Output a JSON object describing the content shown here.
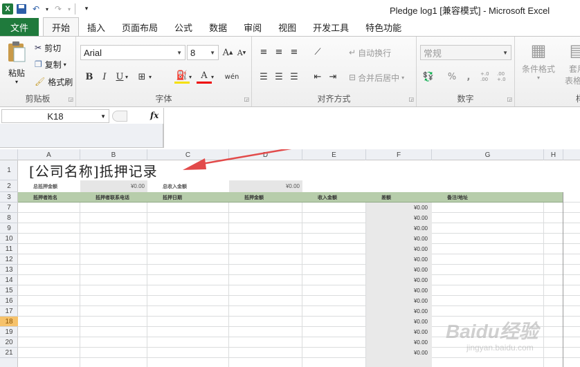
{
  "window": {
    "title": "Pledge log1  [兼容模式]  -  Microsoft Excel",
    "logo": "X"
  },
  "tabs": [
    "文件",
    "开始",
    "插入",
    "页面布局",
    "公式",
    "数据",
    "审阅",
    "视图",
    "开发工具",
    "特色功能"
  ],
  "ribbon": {
    "clipboard": {
      "paste": "粘贴",
      "cut": "剪切",
      "copy": "复制",
      "format_painter": "格式刷",
      "label": "剪贴板"
    },
    "font": {
      "name": "Arial",
      "size": "8",
      "label": "字体",
      "bold": "B",
      "italic": "I",
      "underline": "U"
    },
    "alignment": {
      "wrap_text": "自动换行",
      "merge_center": "合并后居中",
      "label": "对齐方式"
    },
    "number": {
      "format": "常规",
      "percent": "%",
      "comma": ",",
      "inc_decimal": "+.0 .00",
      "dec_decimal": ".00 +.0",
      "label": "数字"
    },
    "styles": {
      "conditional": "条件格式",
      "table_format_1": "套用",
      "table_format_2": "表格格",
      "label": "样"
    }
  },
  "formula_bar": {
    "name_box": "K18",
    "fx": "fx",
    "formula": ""
  },
  "columns": [
    "A",
    "B",
    "C",
    "D",
    "E",
    "F",
    "G",
    "H"
  ],
  "rows": [
    "1",
    "2",
    "3",
    "7",
    "8",
    "9",
    "10",
    "11",
    "12",
    "13",
    "14",
    "15",
    "16",
    "17",
    "18",
    "19",
    "20",
    "21"
  ],
  "sheet": {
    "title": "[公司名称]抵押记录",
    "summary": {
      "total_pledge_label": "总抵押金额",
      "total_pledge_value": "¥0.00",
      "total_income_label": "总收入金额",
      "total_income_value": "¥0.00"
    },
    "headers": [
      "抵押者姓名",
      "抵押者联系电话",
      "抵押日期",
      "抵押金额",
      "收入金额",
      "差额",
      "备注/地址"
    ],
    "diff_values": [
      "¥0.00",
      "¥0.00",
      "¥0.00",
      "¥0.00",
      "¥0.00",
      "¥0.00",
      "¥0.00",
      "¥0.00",
      "¥0.00",
      "¥0.00",
      "¥0.00",
      "¥0.00",
      "¥0.00",
      "¥0.00",
      "¥0.00"
    ]
  },
  "watermark": {
    "brand": "Baidu经验",
    "url": "jingyan.baidu.com"
  },
  "colors": {
    "file_tab": "#1f7a3c",
    "header_row": "#b7cdab",
    "arrow": "#e24a4a",
    "selected_row": "#f6c26b"
  }
}
